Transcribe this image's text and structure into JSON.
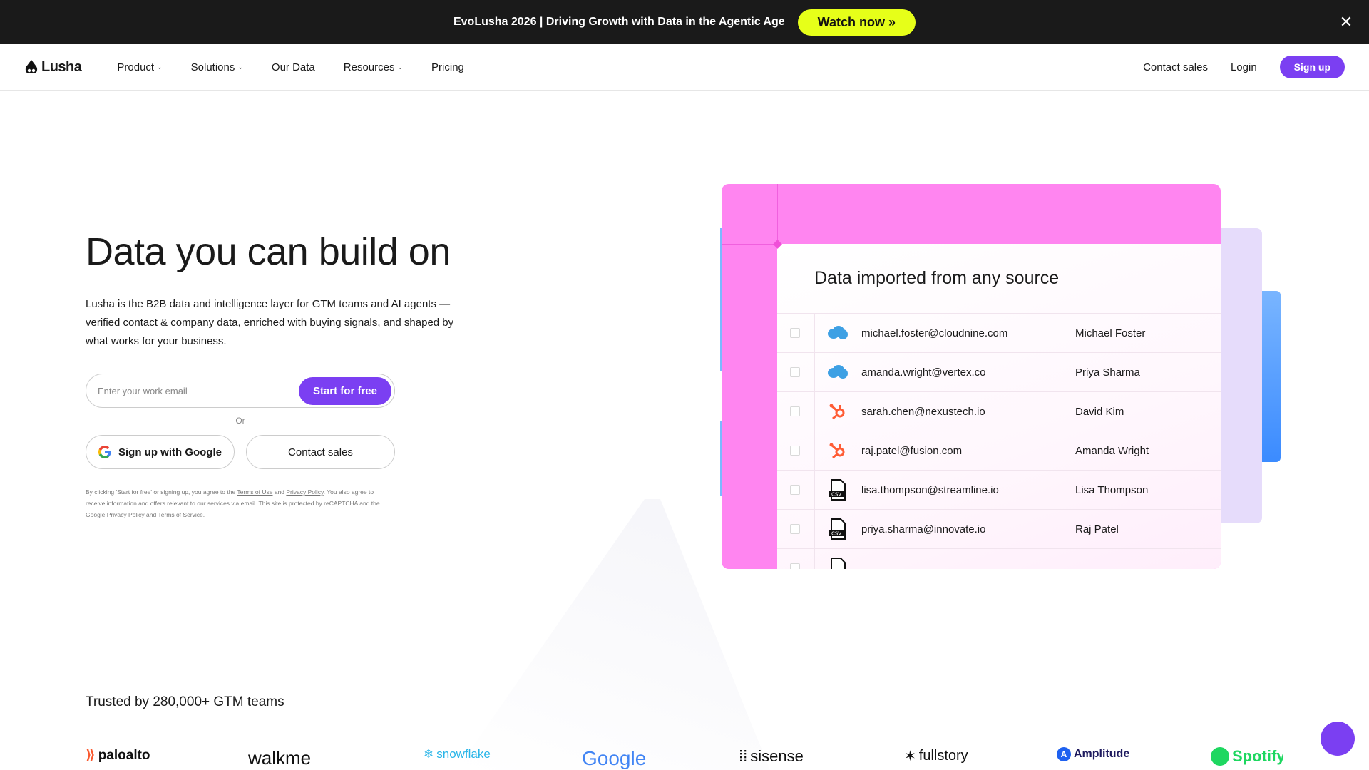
{
  "announcement": {
    "text": "EvoLusha 2026 | Driving Growth with Data in the Agentic Age",
    "cta": "Watch now »",
    "close_icon": "close-icon"
  },
  "nav": {
    "logo_text": "Lusha",
    "links": [
      "Product",
      "Solutions",
      "Our Data",
      "Resources",
      "Pricing"
    ],
    "contact_sales": "Contact sales",
    "login": "Login",
    "signup": "Sign up"
  },
  "hero": {
    "title": "Data you can build on",
    "description": "Lusha is the B2B data and intelligence layer for GTM teams and AI agents — verified contact & company data, enriched with buying signals, and shaped by what works for your business.",
    "email_placeholder": "Enter your work email",
    "start_button": "Start for free",
    "or_text": "Or",
    "google_button": "Sign up with Google",
    "contact_button": "Contact sales",
    "legal_1": "By clicking 'Start for free' or signing up, you agree to the ",
    "legal_terms": "Terms of Use",
    "legal_and": " and ",
    "legal_privacy": "Privacy Policy",
    "legal_2": ". You also agree to receive information and offers relevant to our services via email. This site is protected by reCAPTCHA and the Google ",
    "legal_privacy2": "Privacy Policy",
    "legal_and2": " and ",
    "legal_tos": "Terms of Service",
    "legal_end": "."
  },
  "card": {
    "title": "Data imported from any source",
    "rows": [
      {
        "source": "salesforce-icon",
        "email": "michael.foster@cloudnine.com",
        "name": "Michael Foster"
      },
      {
        "source": "salesforce-icon",
        "email": "amanda.wright@vertex.co",
        "name": "Priya Sharma"
      },
      {
        "source": "hubspot-icon",
        "email": "sarah.chen@nexustech.io",
        "name": "David Kim"
      },
      {
        "source": "hubspot-icon",
        "email": "raj.patel@fusion.com",
        "name": "Amanda Wright"
      },
      {
        "source": "csv-file-icon",
        "email": "lisa.thompson@streamline.io",
        "name": "Lisa Thompson"
      },
      {
        "source": "csv-file-icon",
        "email": "priya.sharma@innovate.io",
        "name": "Raj Patel"
      }
    ]
  },
  "trusted": {
    "title": "Trusted by 280,000+ GTM teams",
    "logos": [
      "paloalto",
      "walkme",
      "snowflake",
      "Google",
      "sisense",
      "fullstory",
      "Amplitude",
      "Spotify"
    ]
  },
  "colors": {
    "accent": "#7b3ff2",
    "announcement_bg": "#1a1a1a",
    "watch_btn": "#e6ff19",
    "card_pink": "#ff85f0"
  }
}
